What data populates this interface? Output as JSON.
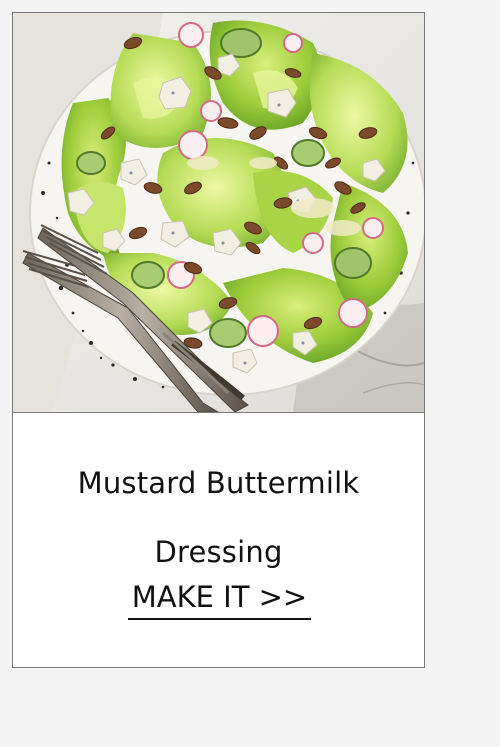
{
  "card": {
    "image": {
      "subject": "salad-photo"
    },
    "title": "Mustard Buttermilk Dressing",
    "cta_label": "MAKE IT >>"
  }
}
